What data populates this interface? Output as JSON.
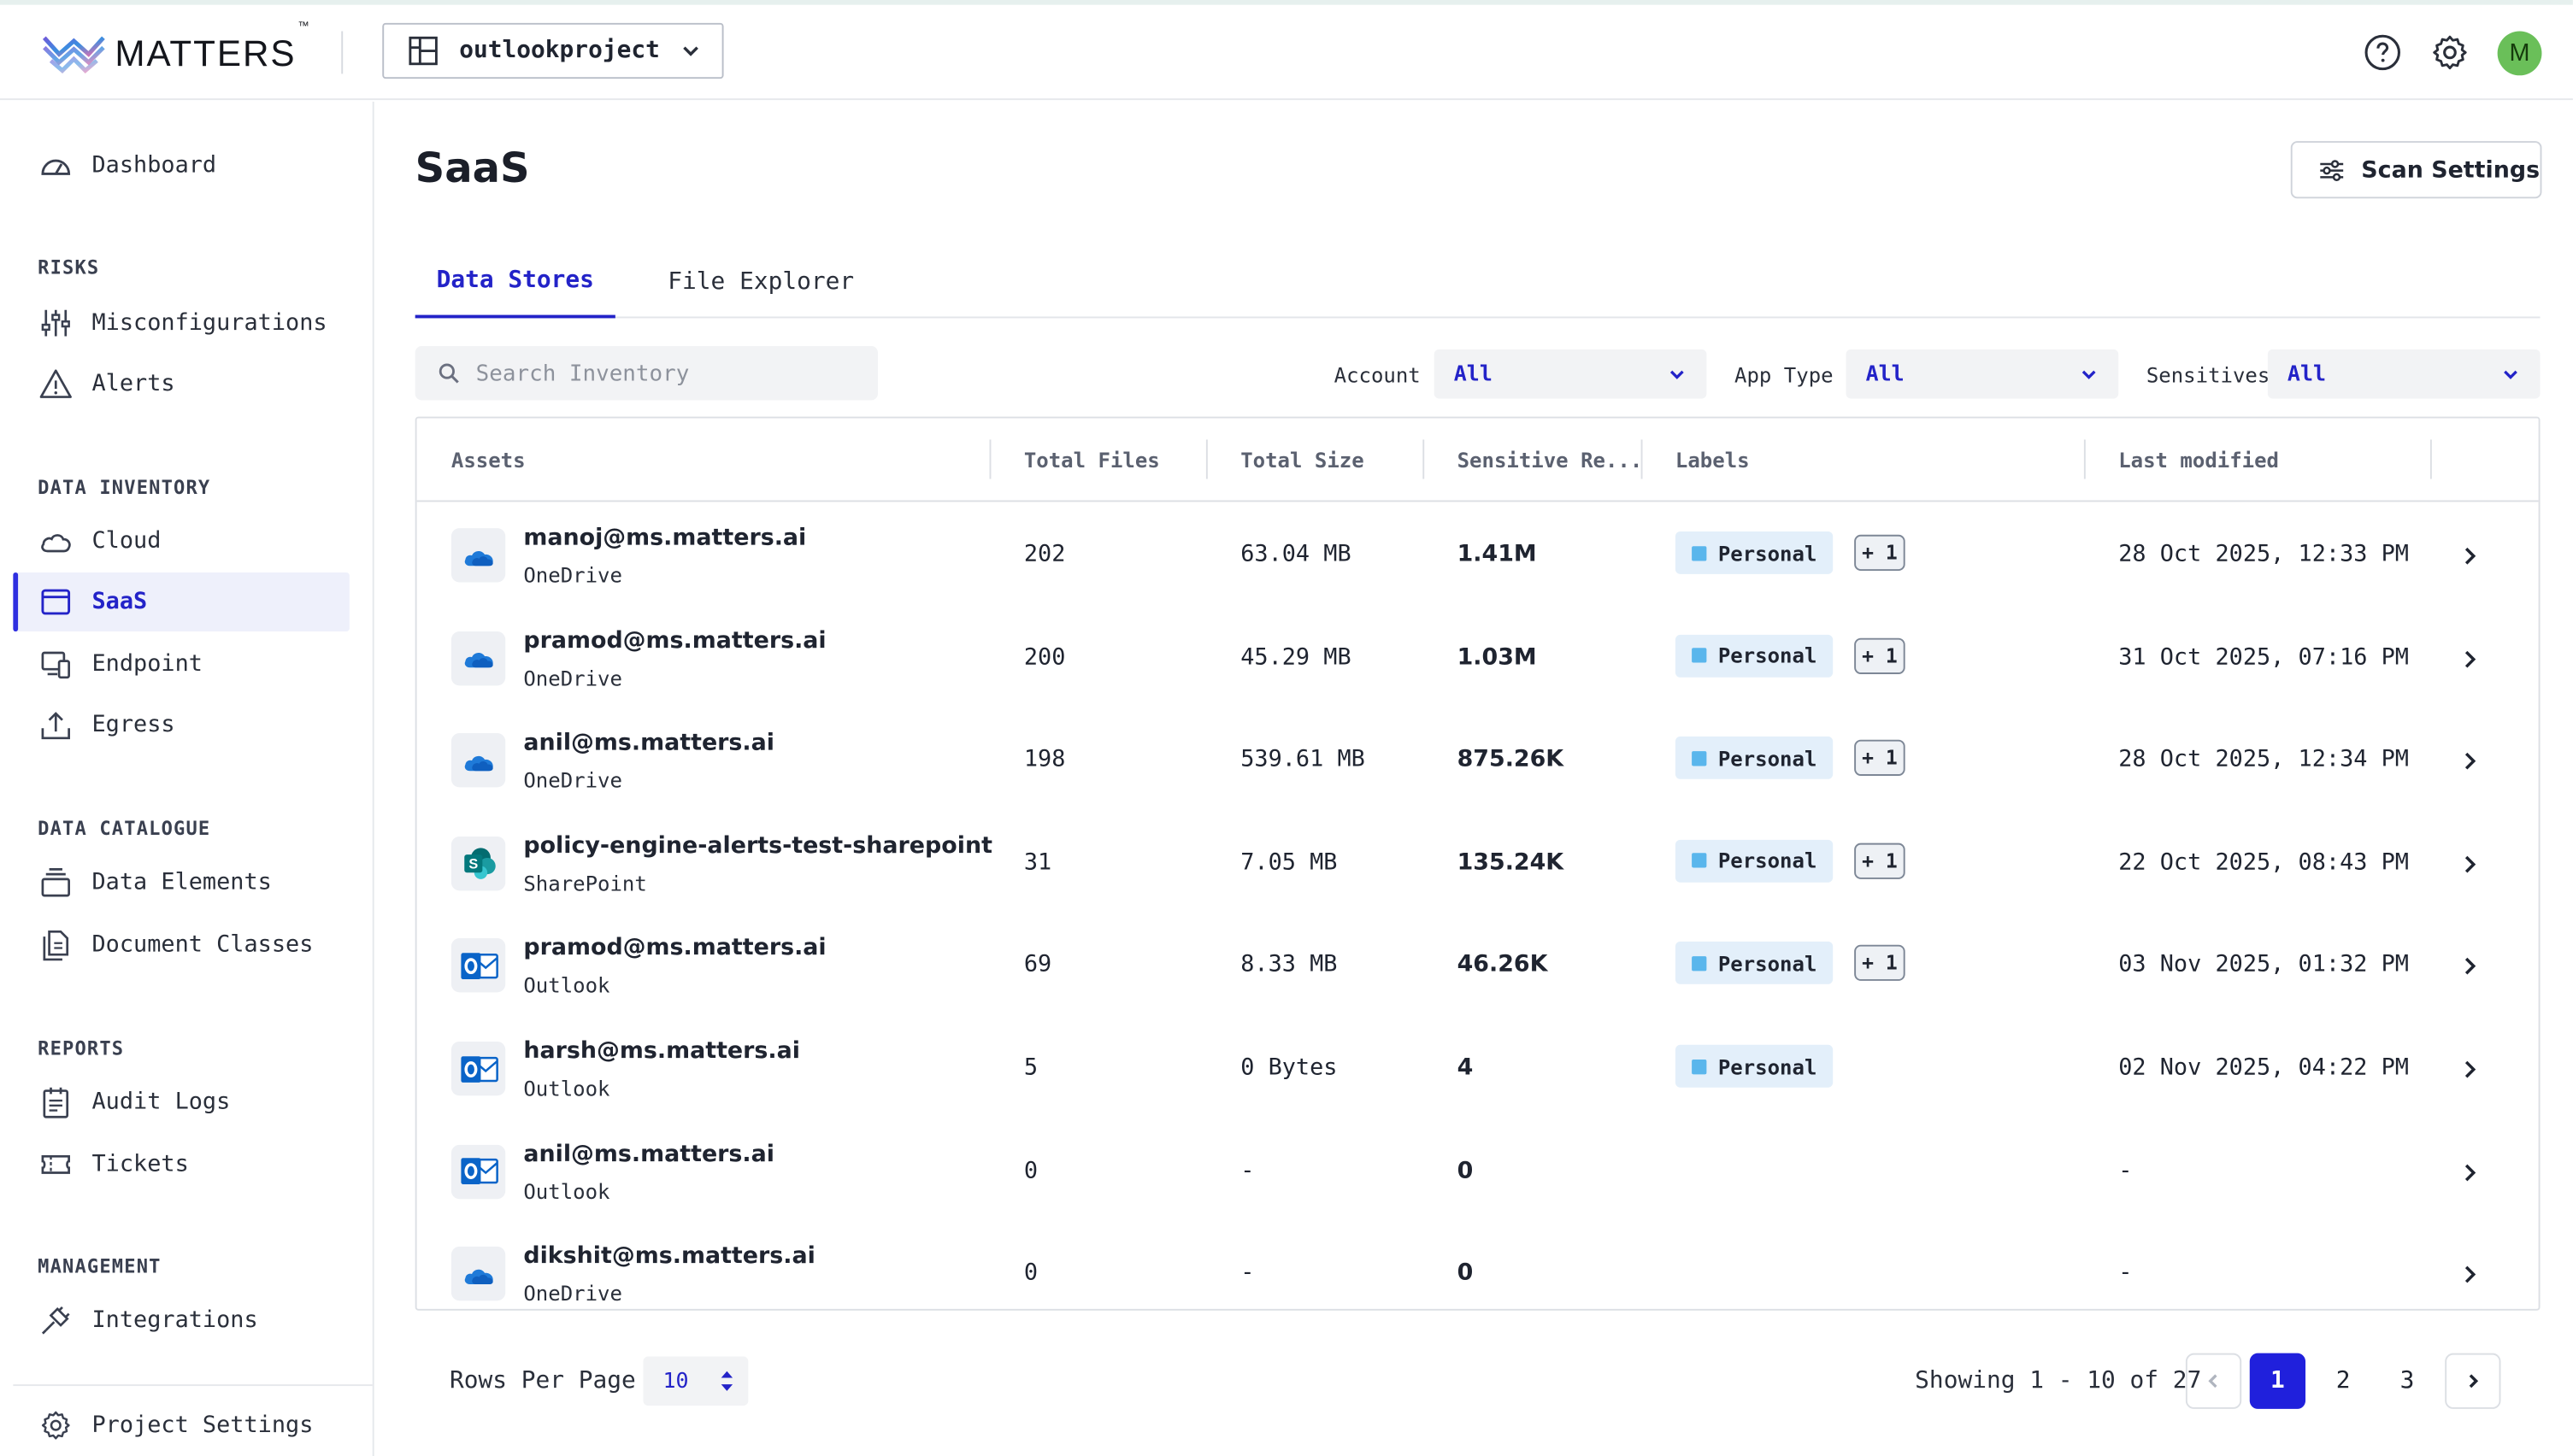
{
  "header": {
    "logo_text": "MATTERS",
    "logo_tm": "™",
    "project": "outlookproject",
    "icons": [
      "help-icon",
      "settings-icon"
    ],
    "avatar_initial": "M"
  },
  "sidebar": {
    "dashboard": "Dashboard",
    "sections": {
      "risks": "RISKS",
      "data_inventory": "DATA INVENTORY",
      "data_catalogue": "DATA CATALOGUE",
      "reports": "REPORTS",
      "management": "MANAGEMENT"
    },
    "items": {
      "misconfigurations": "Misconfigurations",
      "alerts": "Alerts",
      "cloud": "Cloud",
      "saas": "SaaS",
      "endpoint": "Endpoint",
      "egress": "Egress",
      "data_elements": "Data Elements",
      "document_classes": "Document Classes",
      "audit_logs": "Audit Logs",
      "tickets": "Tickets",
      "integrations": "Integrations",
      "project_settings": "Project Settings"
    },
    "active": "SaaS"
  },
  "page": {
    "title": "SaaS",
    "scan_settings": "Scan Settings",
    "tabs": [
      "Data Stores",
      "File Explorer"
    ],
    "active_tab": "Data Stores",
    "search_placeholder": "Search Inventory",
    "filters": {
      "account_label": "Account",
      "account_value": "All",
      "app_type_label": "App Type",
      "app_type_value": "All",
      "sensitives_label": "Sensitives",
      "sensitives_value": "All"
    }
  },
  "table": {
    "columns": [
      "Assets",
      "Total Files",
      "Total Size",
      "Sensitive Re...",
      "Labels",
      "Last modified"
    ],
    "rows": [
      {
        "name": "manoj@ms.matters.ai",
        "type": "OneDrive",
        "icon": "onedrive-icon",
        "files": "202",
        "size": "63.04 MB",
        "sensitive": "1.41M",
        "label": "Personal",
        "extra": "+ 1",
        "modified": "28 Oct 2025, 12:33 PM"
      },
      {
        "name": "pramod@ms.matters.ai",
        "type": "OneDrive",
        "icon": "onedrive-icon",
        "files": "200",
        "size": "45.29 MB",
        "sensitive": "1.03M",
        "label": "Personal",
        "extra": "+ 1",
        "modified": "31 Oct 2025, 07:16 PM"
      },
      {
        "name": "anil@ms.matters.ai",
        "type": "OneDrive",
        "icon": "onedrive-icon",
        "files": "198",
        "size": "539.61 MB",
        "sensitive": "875.26K",
        "label": "Personal",
        "extra": "+ 1",
        "modified": "28 Oct 2025, 12:34 PM"
      },
      {
        "name": "policy-engine-alerts-test-sharepoint",
        "type": "SharePoint",
        "icon": "sharepoint-icon",
        "files": "31",
        "size": "7.05 MB",
        "sensitive": "135.24K",
        "label": "Personal",
        "extra": "+ 1",
        "modified": "22 Oct 2025, 08:43 PM"
      },
      {
        "name": "pramod@ms.matters.ai",
        "type": "Outlook",
        "icon": "outlook-icon",
        "files": "69",
        "size": "8.33 MB",
        "sensitive": "46.26K",
        "label": "Personal",
        "extra": "+ 1",
        "modified": "03 Nov 2025, 01:32 PM"
      },
      {
        "name": "harsh@ms.matters.ai",
        "type": "Outlook",
        "icon": "outlook-icon",
        "files": "5",
        "size": "0 Bytes",
        "sensitive": "4",
        "label": "Personal",
        "extra": "",
        "modified": "02 Nov 2025, 04:22 PM"
      },
      {
        "name": "anil@ms.matters.ai",
        "type": "Outlook",
        "icon": "outlook-icon",
        "files": "0",
        "size": "-",
        "sensitive": "0",
        "label": "",
        "extra": "",
        "modified": "-"
      },
      {
        "name": "dikshit@ms.matters.ai",
        "type": "OneDrive",
        "icon": "onedrive-icon",
        "files": "0",
        "size": "-",
        "sensitive": "0",
        "label": "",
        "extra": "",
        "modified": "-"
      }
    ]
  },
  "footer": {
    "rows_per_page_label": "Rows Per Page",
    "rows_per_page_value": "10",
    "showing": "Showing 1 - 10 of 27",
    "pages": [
      "1",
      "2",
      "3"
    ],
    "current_page": "1"
  },
  "colors": {
    "accent": "#2323c8",
    "active_page": "#2020dc",
    "label_bg": "#e3effa",
    "label_dot": "#5ab6ec",
    "avatar_bg": "#6abf59"
  }
}
